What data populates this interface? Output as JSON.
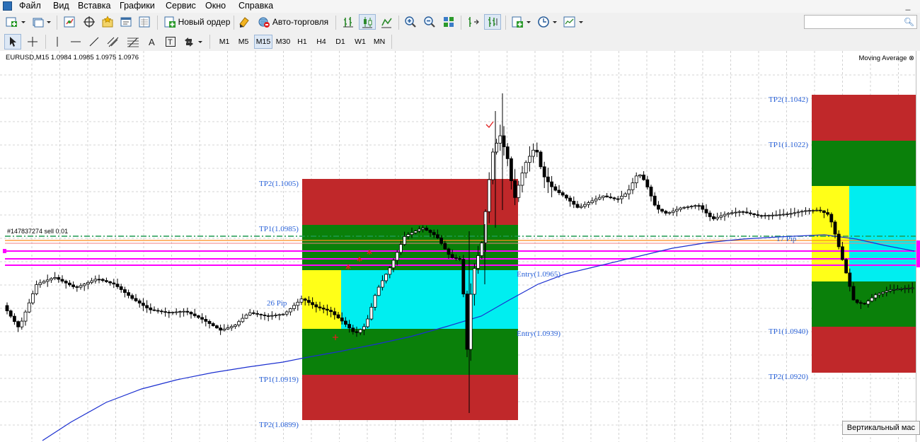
{
  "menu": {
    "items": [
      "Файл",
      "Вид",
      "Вставка",
      "Графики",
      "Сервис",
      "Окно",
      "Справка"
    ],
    "minimize": "_"
  },
  "toolbar": {
    "new_order": "Новый ордер",
    "auto_trading": "Авто-торговля"
  },
  "timeframes": [
    "M1",
    "M5",
    "M15",
    "M30",
    "H1",
    "H4",
    "D1",
    "W1",
    "MN"
  ],
  "active_timeframe": "M15",
  "chart": {
    "header": "EURUSD,M15  1.0984 1.0985 1.0975 1.0976",
    "indicator": "Moving Average",
    "order_label": "#147837274 sell 0.01",
    "tooltip": "Вертикальный мас",
    "zone1": {
      "tp2_top": "TP2(1.1005)",
      "tp1_top": "TP1(1.0985)",
      "entry_upper": "Entry(1.0965)",
      "pips": "26 Pip",
      "entry_lower": "Entry(1.0939)",
      "tp1_bottom": "TP1(1.0919)",
      "tp2_bottom": "TP2(1.0899)"
    },
    "zone2": {
      "tp2_top": "TP2(1.1042)",
      "tp1_top": "TP1(1.1022)",
      "pips": "17 Pip",
      "tp1_bottom": "TP1(1.0940)",
      "tp2_bottom": "TP2(1.0920)"
    }
  },
  "colors": {
    "zone_red": "#c0282a",
    "zone_green": "#0a800a",
    "zone_yellow": "#ffff18",
    "zone_cyan": "#00eef0",
    "ma_line": "#1b2fd0",
    "magenta_lines": "#ff00ff",
    "orange_line": "#ff8c1a",
    "dashed_line": "#1e9a50",
    "label_blue": "#2a62d8",
    "grid": "#c8c8c8"
  }
}
